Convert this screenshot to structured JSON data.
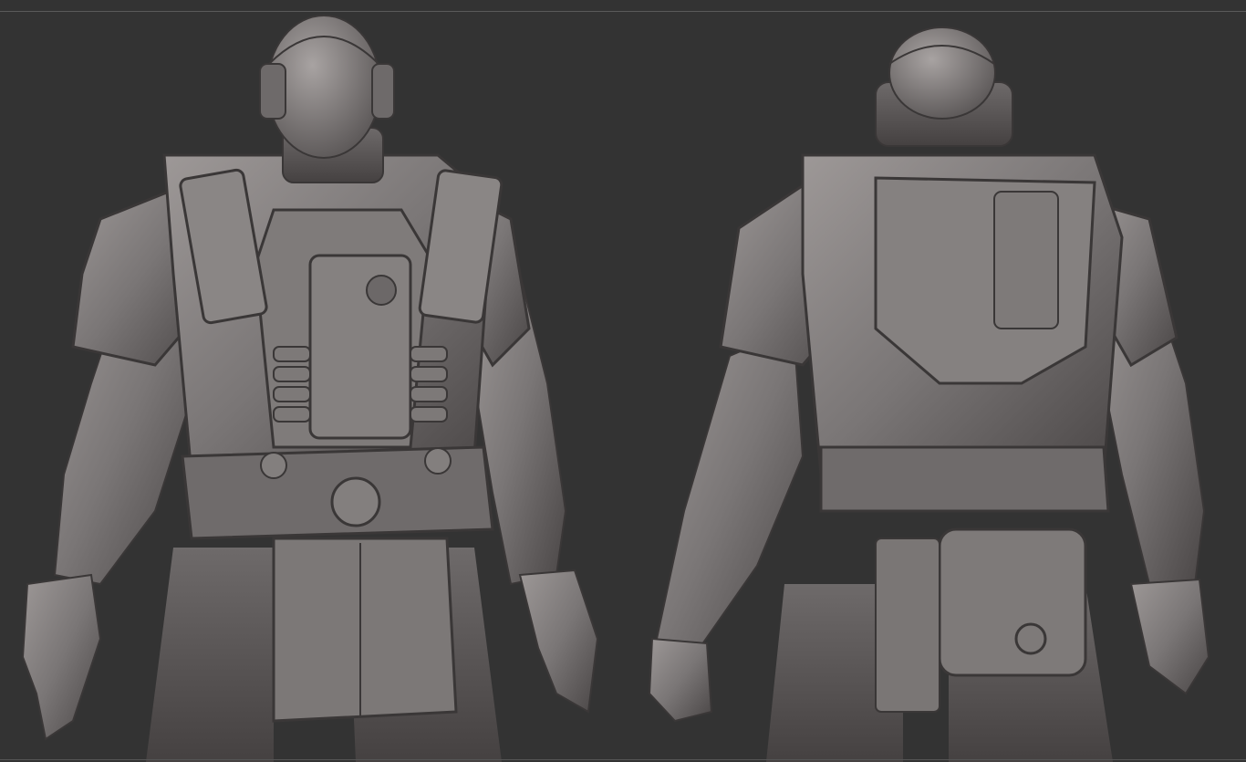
{
  "canvas": {
    "background": "#333333",
    "material_color": "#7a7676",
    "material_highlight": "#a7a2a0",
    "material_shadow": "#3e3b3b"
  },
  "models": [
    {
      "view": "front"
    },
    {
      "view": "back"
    }
  ]
}
